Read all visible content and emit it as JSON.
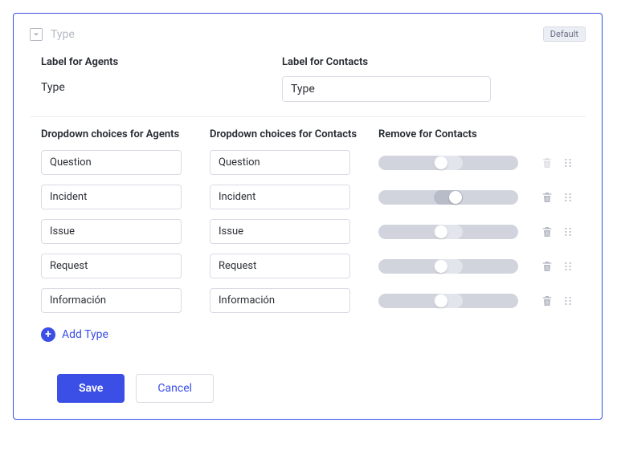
{
  "header": {
    "field_name": "Type",
    "badge": "Default"
  },
  "labels": {
    "agents_heading": "Label for Agents",
    "agents_value": "Type",
    "contacts_heading": "Label for Contacts",
    "contacts_value": "Type"
  },
  "choices": {
    "agents_heading": "Dropdown choices for Agents",
    "contacts_heading": "Dropdown choices for Contacts",
    "remove_heading": "Remove for Contacts",
    "rows": [
      {
        "agent": "Question",
        "contact": "Question",
        "remove_on": false,
        "delete_enabled": false
      },
      {
        "agent": "Incident",
        "contact": "Incident",
        "remove_on": true,
        "delete_enabled": true
      },
      {
        "agent": "Issue",
        "contact": "Issue",
        "remove_on": false,
        "delete_enabled": true
      },
      {
        "agent": "Request",
        "contact": "Request",
        "remove_on": false,
        "delete_enabled": true
      },
      {
        "agent": "Información",
        "contact": "Información",
        "remove_on": false,
        "delete_enabled": true
      }
    ]
  },
  "add_label": "Add Type",
  "footer": {
    "save": "Save",
    "cancel": "Cancel"
  }
}
